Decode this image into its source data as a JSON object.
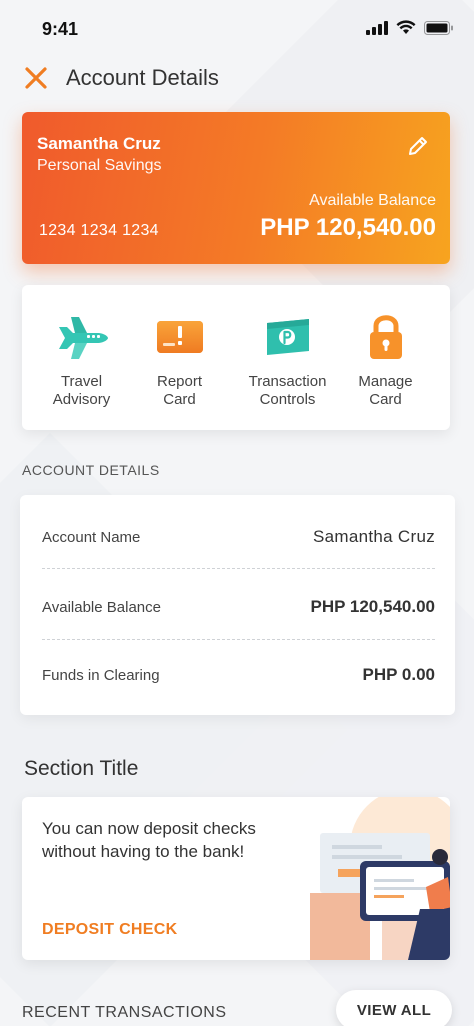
{
  "status_bar": {
    "time": "9:41"
  },
  "header": {
    "title": "Account Details"
  },
  "account_card": {
    "name": "Samantha Cruz",
    "type": "Personal Savings",
    "available_label": "Available Balance",
    "account_number": "1234 1234 1234",
    "balance": "PHP 120,540.00"
  },
  "quick_actions": [
    {
      "label": "Travel\nAdvisory",
      "icon": "airplane-icon"
    },
    {
      "label": "Report\nCard",
      "icon": "report-card-icon"
    },
    {
      "label": "Transaction\nControls",
      "icon": "transaction-controls-icon"
    },
    {
      "label": "Manage\nCard",
      "icon": "lock-icon"
    }
  ],
  "account_details": {
    "section_label": "ACCOUNT DETAILS",
    "rows": [
      {
        "label": "Account Name",
        "value": "Samantha Cruz"
      },
      {
        "label": "Available Balance",
        "value": "PHP 120,540.00"
      },
      {
        "label": "Funds in Clearing",
        "value": "PHP 0.00"
      }
    ]
  },
  "promo": {
    "section_title": "Section Title",
    "text": "You can now deposit checks without having to the bank!",
    "cta": "DEPOSIT CHECK"
  },
  "recent": {
    "label": "RECENT TRANSACTIONS",
    "view_all": "VIEW ALL"
  },
  "colors": {
    "accent": "#f07d22",
    "card_gradient_start": "#f05a2c",
    "card_gradient_end": "#f7a41f",
    "teal": "#2fc4b2"
  }
}
